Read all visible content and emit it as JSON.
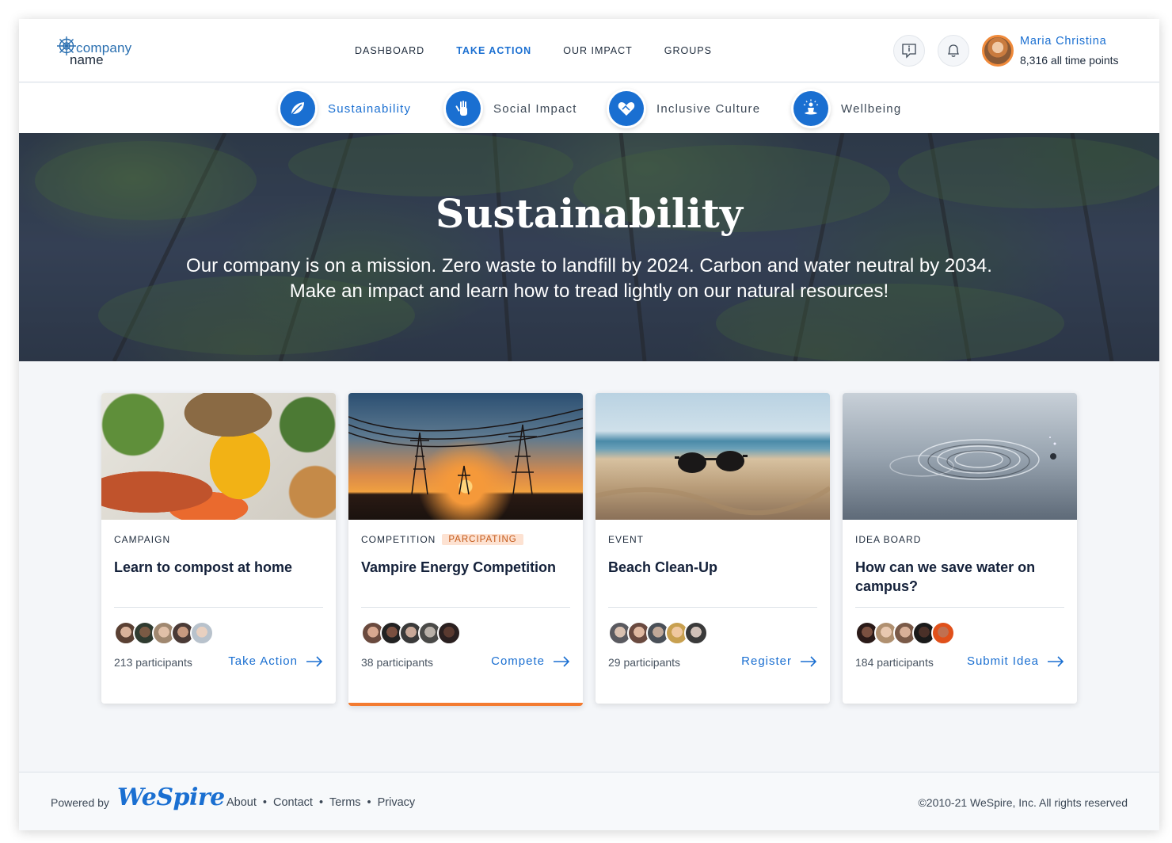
{
  "brand": {
    "line1": "company",
    "line2": "name"
  },
  "nav": [
    {
      "label": "DASHBOARD",
      "active": false
    },
    {
      "label": "TAKE ACTION",
      "active": true
    },
    {
      "label": "OUR IMPACT",
      "active": false
    },
    {
      "label": "GROUPS",
      "active": false
    }
  ],
  "header_icons": [
    "info-chat-icon",
    "bell-icon"
  ],
  "user": {
    "name": "Maria Christina",
    "points": "8,316 all time points"
  },
  "categories": [
    {
      "label": "Sustainability",
      "icon": "leaf-icon",
      "active": true
    },
    {
      "label": "Social Impact",
      "icon": "raised-hand-icon",
      "active": false
    },
    {
      "label": "Inclusive Culture",
      "icon": "heart-hands-icon",
      "active": false
    },
    {
      "label": "Wellbeing",
      "icon": "meditation-icon",
      "active": false
    }
  ],
  "hero": {
    "title": "Sustainability",
    "text": "Our company is on a mission. Zero waste to landfill by 2024. Carbon and water neutral by 2034. Make an impact and learn how to tread lightly on our natural resources!"
  },
  "cards": [
    {
      "type": "CAMPAIGN",
      "badge": "",
      "title": "Learn to compost at home",
      "participants": "213 participants",
      "action": "Take Action",
      "image": "vegetables-image"
    },
    {
      "type": "COMPETITION",
      "badge": "PARCIPATING",
      "title": "Vampire Energy Competition",
      "participants": "38 participants",
      "action": "Compete",
      "image": "power-lines-sunset-image"
    },
    {
      "type": "EVENT",
      "badge": "",
      "title": "Beach Clean-Up",
      "participants": "29 participants",
      "action": "Register",
      "image": "sunglasses-beach-image"
    },
    {
      "type": "IDEA BOARD",
      "badge": "",
      "title": "How can we save water on campus?",
      "participants": "184 participants",
      "action": "Submit Idea",
      "image": "water-ripple-image"
    }
  ],
  "footer": {
    "powered_by": "Powered by",
    "brand": "WeSpire",
    "links": [
      "About",
      "Contact",
      "Terms",
      "Privacy"
    ],
    "copyright": "©2010-21 WeSpire, Inc. All rights reserved"
  },
  "colors": {
    "accent": "#1a6fd1",
    "highlight": "#f37b30",
    "badge_bg": "#fde2d2"
  }
}
